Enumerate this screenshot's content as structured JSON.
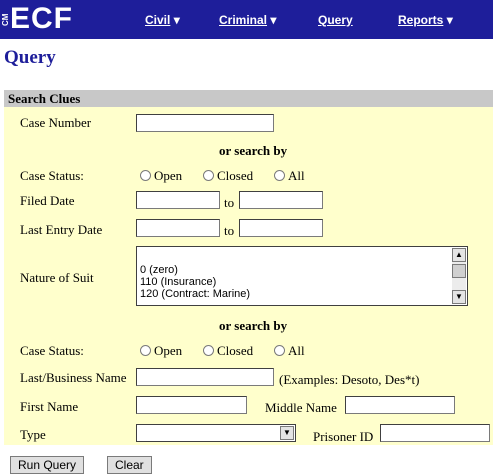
{
  "app": {
    "logo_cm": "CM",
    "logo_ecf": "ECF"
  },
  "menu": [
    {
      "label": "Civil",
      "arrow": "▾"
    },
    {
      "label": "Criminal",
      "arrow": "▾"
    },
    {
      "label": "Query"
    },
    {
      "label": "Reports",
      "arrow": "▾"
    }
  ],
  "page_title": "Query",
  "form": {
    "section_header": "Search Clues",
    "case_number_label": "Case Number",
    "or_search_by": "or search by",
    "case_status_label": "Case Status:",
    "status_options": [
      "Open",
      "Closed",
      "All"
    ],
    "filed_date_label": "Filed Date",
    "last_entry_date_label": "Last Entry Date",
    "to": "to",
    "nature_of_suit_label": "Nature of Suit",
    "nature_of_suit_options": [
      "0 (zero)",
      "110 (Insurance)",
      "120 (Contract: Marine)"
    ],
    "last_business_name_label": "Last/Business Name",
    "examples": "(Examples: Desoto, Des*t)",
    "first_name_label": "First Name",
    "middle_name_label": "Middle Name",
    "type_label": "Type",
    "prisoner_id_label": "Prisoner ID"
  },
  "buttons": {
    "run_query": "Run Query",
    "clear": "Clear"
  }
}
